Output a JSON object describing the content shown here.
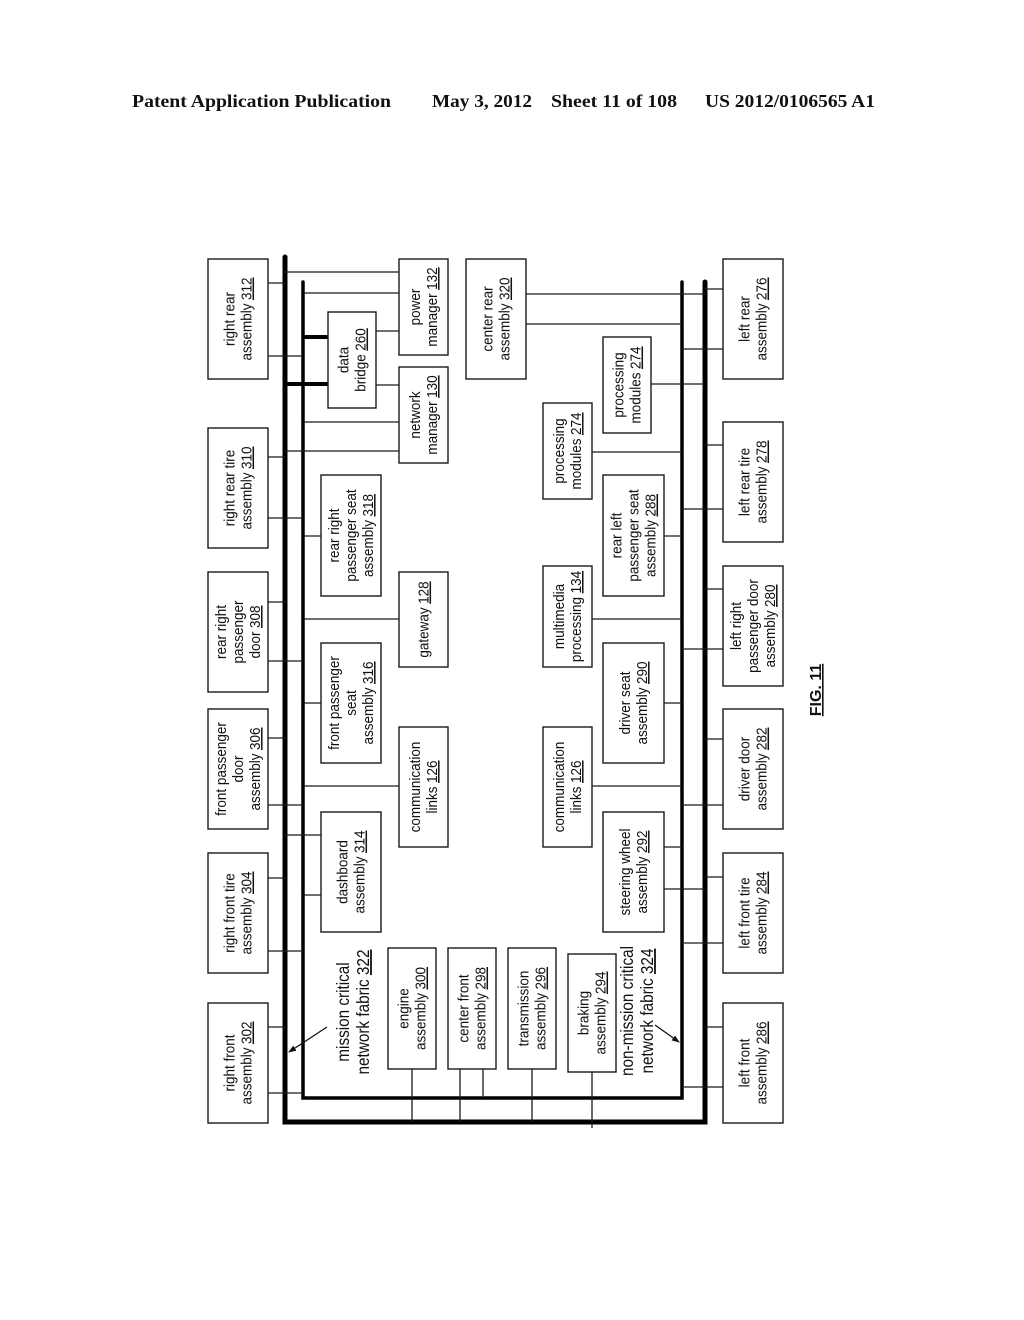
{
  "header": {
    "publication": "Patent Application Publication",
    "date": "May 3, 2012",
    "sheet": "Sheet 11 of 108",
    "number": "US 2012/0106565 A1"
  },
  "figure": {
    "label": "FIG. 11",
    "fabrics": {
      "mission_critical": {
        "lines": [
          "mission critical",
          "network fabric"
        ],
        "ref": "322"
      },
      "non_mission_critical": {
        "lines": [
          "non-mission critical",
          "network fabric"
        ],
        "ref": "324"
      }
    },
    "blocks": {
      "right_rear_assembly": {
        "lines": [
          "right rear",
          "assembly"
        ],
        "ref": "312"
      },
      "right_rear_tire_assembly": {
        "lines": [
          "right rear tire",
          "assembly"
        ],
        "ref": "310"
      },
      "rear_right_passenger_door": {
        "lines": [
          "rear right",
          "passenger",
          "door"
        ],
        "ref": "308"
      },
      "front_passenger_door_assembly": {
        "lines": [
          "front passenger",
          "door",
          "assembly"
        ],
        "ref": "306"
      },
      "right_front_tire_assembly": {
        "lines": [
          "right front tire",
          "assembly"
        ],
        "ref": "304"
      },
      "right_front_assembly": {
        "lines": [
          "right front",
          "assembly"
        ],
        "ref": "302"
      },
      "rear_right_passenger_seat_assembly": {
        "lines": [
          "rear right",
          "passenger seat",
          "assembly"
        ],
        "ref": "318"
      },
      "front_passenger_seat_assembly": {
        "lines": [
          "front passenger",
          "seat",
          "assembly"
        ],
        "ref": "316"
      },
      "dashboard_assembly": {
        "lines": [
          "dashboard",
          "assembly"
        ],
        "ref": "314"
      },
      "data_bridge": {
        "lines": [
          "data",
          "bridge"
        ],
        "ref": "260"
      },
      "power_manager": {
        "lines": [
          "power",
          "manager"
        ],
        "ref": "132"
      },
      "network_manager": {
        "lines": [
          "network",
          "manager"
        ],
        "ref": "130"
      },
      "gateway": {
        "lines": [
          "gateway"
        ],
        "ref": "128"
      },
      "communication_links_right": {
        "lines": [
          "communication",
          "links"
        ],
        "ref": "126"
      },
      "engine_assembly": {
        "lines": [
          "engine",
          "assembly"
        ],
        "ref": "300"
      },
      "center_front_assembly": {
        "lines": [
          "center front",
          "assembly"
        ],
        "ref": "298"
      },
      "transmission_assembly": {
        "lines": [
          "transmission",
          "assembly"
        ],
        "ref": "296"
      },
      "braking_assembly": {
        "lines": [
          "braking",
          "assembly"
        ],
        "ref": "294"
      },
      "center_rear_assembly": {
        "lines": [
          "center rear",
          "assembly"
        ],
        "ref": "320"
      },
      "processing_modules_upper": {
        "lines": [
          "processing",
          "modules"
        ],
        "ref": "274"
      },
      "processing_modules_lower": {
        "lines": [
          "processing",
          "modules"
        ],
        "ref": "274"
      },
      "multimedia_processing": {
        "lines": [
          "multimedia",
          "processing"
        ],
        "ref": "134"
      },
      "communication_links_left": {
        "lines": [
          "communication",
          "links"
        ],
        "ref": "126"
      },
      "rear_left_passenger_seat_assembly": {
        "lines": [
          "rear left",
          "passenger seat",
          "assembly"
        ],
        "ref": "288"
      },
      "driver_seat_assembly": {
        "lines": [
          "driver seat",
          "assembly"
        ],
        "ref": "290"
      },
      "steering_wheel_assembly": {
        "lines": [
          "steering wheel",
          "assembly"
        ],
        "ref": "292"
      },
      "left_rear_assembly": {
        "lines": [
          "left rear",
          "assembly"
        ],
        "ref": "276"
      },
      "left_rear_tire_assembly": {
        "lines": [
          "left rear tire",
          "assembly"
        ],
        "ref": "278"
      },
      "left_right_passenger_door_assembly": {
        "lines": [
          "left right",
          "passenger door",
          "assembly"
        ],
        "ref": "280"
      },
      "driver_door_assembly": {
        "lines": [
          "driver door",
          "assembly"
        ],
        "ref": "282"
      },
      "left_front_tire_assembly": {
        "lines": [
          "left front tire",
          "assembly"
        ],
        "ref": "284"
      },
      "left_front_assembly": {
        "lines": [
          "left front",
          "assembly"
        ],
        "ref": "286"
      }
    }
  }
}
